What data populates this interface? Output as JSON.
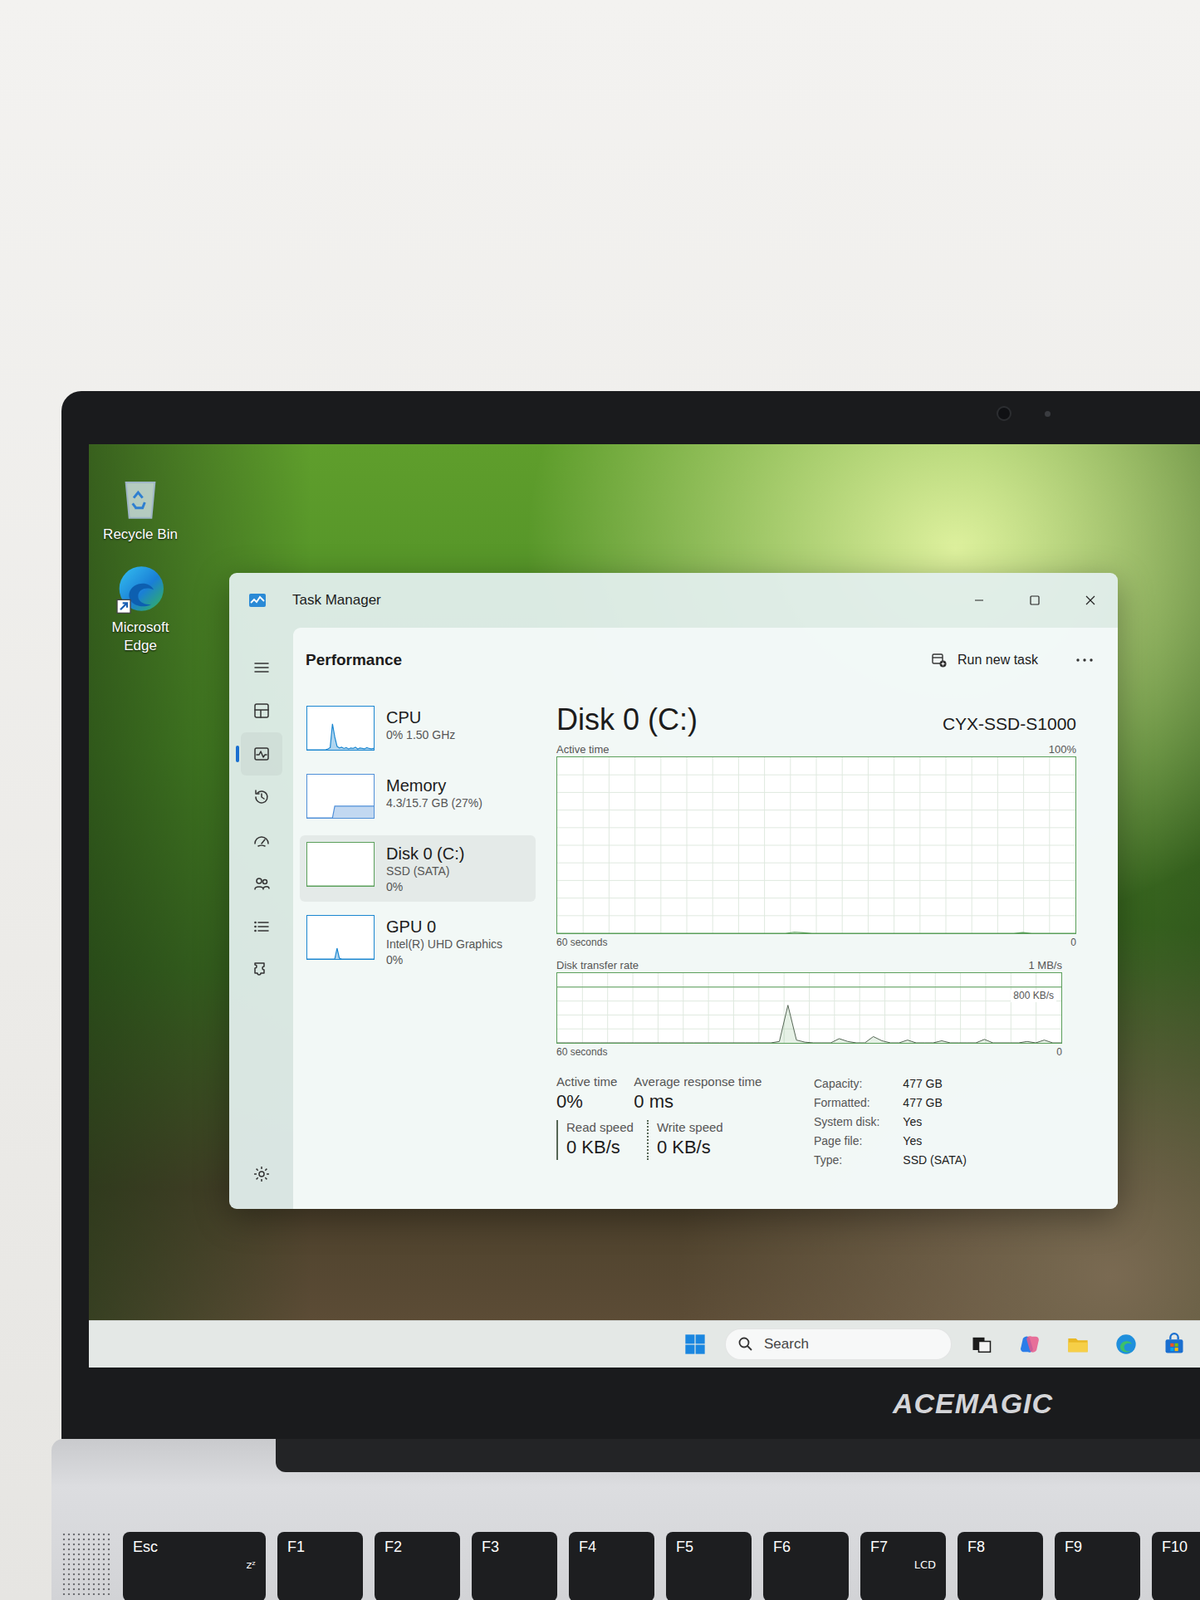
{
  "desktop_icons": [
    {
      "label": "Recycle Bin",
      "kind": "recycle-bin"
    },
    {
      "label": "Microsoft Edge",
      "kind": "edge"
    }
  ],
  "window": {
    "title": "Task Manager"
  },
  "nav": [
    {
      "kind": "menu",
      "selected": false
    },
    {
      "kind": "processes",
      "selected": false
    },
    {
      "kind": "performance",
      "selected": true
    },
    {
      "kind": "history",
      "selected": false
    },
    {
      "kind": "startup",
      "selected": false
    },
    {
      "kind": "users",
      "selected": false
    },
    {
      "kind": "details",
      "selected": false
    },
    {
      "kind": "services",
      "selected": false
    }
  ],
  "nav_bottom": {
    "kind": "settings",
    "selected": false
  },
  "page": {
    "title": "Performance",
    "action": "Run new task"
  },
  "devices": [
    {
      "name": "CPU",
      "lines": [
        "0% 1.50 GHz"
      ],
      "selected": false,
      "color": "#1a86d0",
      "series": [
        0,
        0,
        0,
        0,
        0,
        0,
        0,
        0,
        0,
        2,
        5,
        60,
        30,
        8,
        4,
        6,
        3,
        5,
        2,
        4,
        3,
        6,
        2,
        4,
        3,
        2,
        5,
        3,
        2,
        3
      ]
    },
    {
      "name": "Memory",
      "lines": [
        "4.3/15.7 GB (27%)"
      ],
      "selected": false,
      "color": "#4f8fd8",
      "series": [
        0,
        0,
        0,
        0,
        0,
        0,
        0,
        0,
        0,
        0,
        0,
        0,
        27,
        27,
        27,
        27,
        27,
        27,
        27,
        27,
        27,
        27,
        27,
        27,
        27,
        27,
        27,
        27,
        27,
        27
      ]
    },
    {
      "name": "Disk 0 (C:)",
      "lines": [
        "SSD (SATA)",
        "0%"
      ],
      "selected": true,
      "color": "#5a9f5a",
      "series": [
        0,
        0,
        0,
        0,
        0,
        0,
        0,
        0,
        0,
        0,
        0,
        0,
        0,
        0,
        0,
        0,
        0,
        0,
        0,
        0,
        0,
        0,
        0,
        0,
        0,
        0,
        0,
        0,
        0,
        0
      ]
    },
    {
      "name": "GPU 0",
      "lines": [
        "Intel(R) UHD Graphics",
        "0%"
      ],
      "selected": false,
      "color": "#1a86d0",
      "series": [
        0,
        0,
        0,
        0,
        0,
        0,
        0,
        0,
        0,
        0,
        0,
        0,
        0,
        25,
        2,
        0,
        0,
        0,
        0,
        0,
        0,
        0,
        0,
        0,
        0,
        0,
        0,
        0,
        0,
        0
      ]
    }
  ],
  "detail": {
    "title": "Disk 0 (C:)",
    "model": "CYX-SSD-S1000",
    "active_chart": {
      "label": "Active time",
      "max": "100%",
      "span": "60 seconds",
      "min": "0",
      "max_value": 100,
      "values": [
        0,
        0,
        0,
        0,
        0,
        0,
        0,
        0,
        0,
        0,
        0,
        0,
        0,
        0,
        0,
        0,
        0,
        0,
        0,
        0,
        0,
        0,
        0,
        0,
        0,
        0,
        0,
        0.6,
        0.3,
        0,
        0,
        0,
        0,
        0,
        0,
        0,
        0,
        0,
        0,
        0,
        0,
        0,
        0,
        0,
        0,
        0,
        0,
        0,
        0,
        0,
        0,
        0,
        0,
        0.4,
        0,
        0,
        0,
        0,
        0,
        0
      ]
    },
    "transfer_chart": {
      "label": "Disk transfer rate",
      "max": "1 MB/s",
      "mid": "800 KB/s",
      "span": "60 seconds",
      "min": "0",
      "max_value": 1000,
      "mid_value": 800,
      "values": [
        0,
        0,
        0,
        0,
        0,
        0,
        0,
        0,
        0,
        0,
        0,
        0,
        0,
        0,
        0,
        0,
        0,
        0,
        0,
        0,
        0,
        0,
        0,
        0,
        0,
        0,
        20,
        540,
        40,
        10,
        0,
        0,
        0,
        60,
        20,
        0,
        0,
        90,
        30,
        0,
        0,
        40,
        0,
        0,
        0,
        30,
        0,
        0,
        0,
        0,
        50,
        0,
        0,
        0,
        0,
        20,
        0,
        40,
        0,
        0
      ]
    },
    "stats": [
      {
        "label": "Active time",
        "value": "0%"
      },
      {
        "label": "Average response time",
        "value": "0 ms"
      }
    ],
    "speeds": [
      {
        "label": "Read speed",
        "value": "0 KB/s",
        "kind": "solid"
      },
      {
        "label": "Write speed",
        "value": "0 KB/s",
        "kind": "dashed"
      }
    ],
    "properties": [
      {
        "label": "Capacity:",
        "value": "477 GB"
      },
      {
        "label": "Formatted:",
        "value": "477 GB"
      },
      {
        "label": "System disk:",
        "value": "Yes"
      },
      {
        "label": "Page file:",
        "value": "Yes"
      },
      {
        "label": "Type:",
        "value": "SSD (SATA)"
      }
    ]
  },
  "taskbar": {
    "search": "Search",
    "apps": [
      {
        "kind": "task-view"
      },
      {
        "kind": "copilot"
      },
      {
        "kind": "explorer"
      },
      {
        "kind": "edge"
      },
      {
        "kind": "store"
      },
      {
        "kind": "app"
      }
    ]
  },
  "brand": "ACEMAGIC",
  "keys": [
    {
      "label": "Esc",
      "sub": "zᶻ"
    },
    {
      "label": "F1",
      "sub": ""
    },
    {
      "label": "F2",
      "sub": ""
    },
    {
      "label": "F3",
      "sub": ""
    },
    {
      "label": "F4",
      "sub": ""
    },
    {
      "label": "F5",
      "sub": ""
    },
    {
      "label": "F6",
      "sub": ""
    },
    {
      "label": "F7",
      "sub": "LCD"
    },
    {
      "label": "F8",
      "sub": ""
    },
    {
      "label": "F9",
      "sub": ""
    },
    {
      "label": "F10",
      "sub": ""
    }
  ]
}
